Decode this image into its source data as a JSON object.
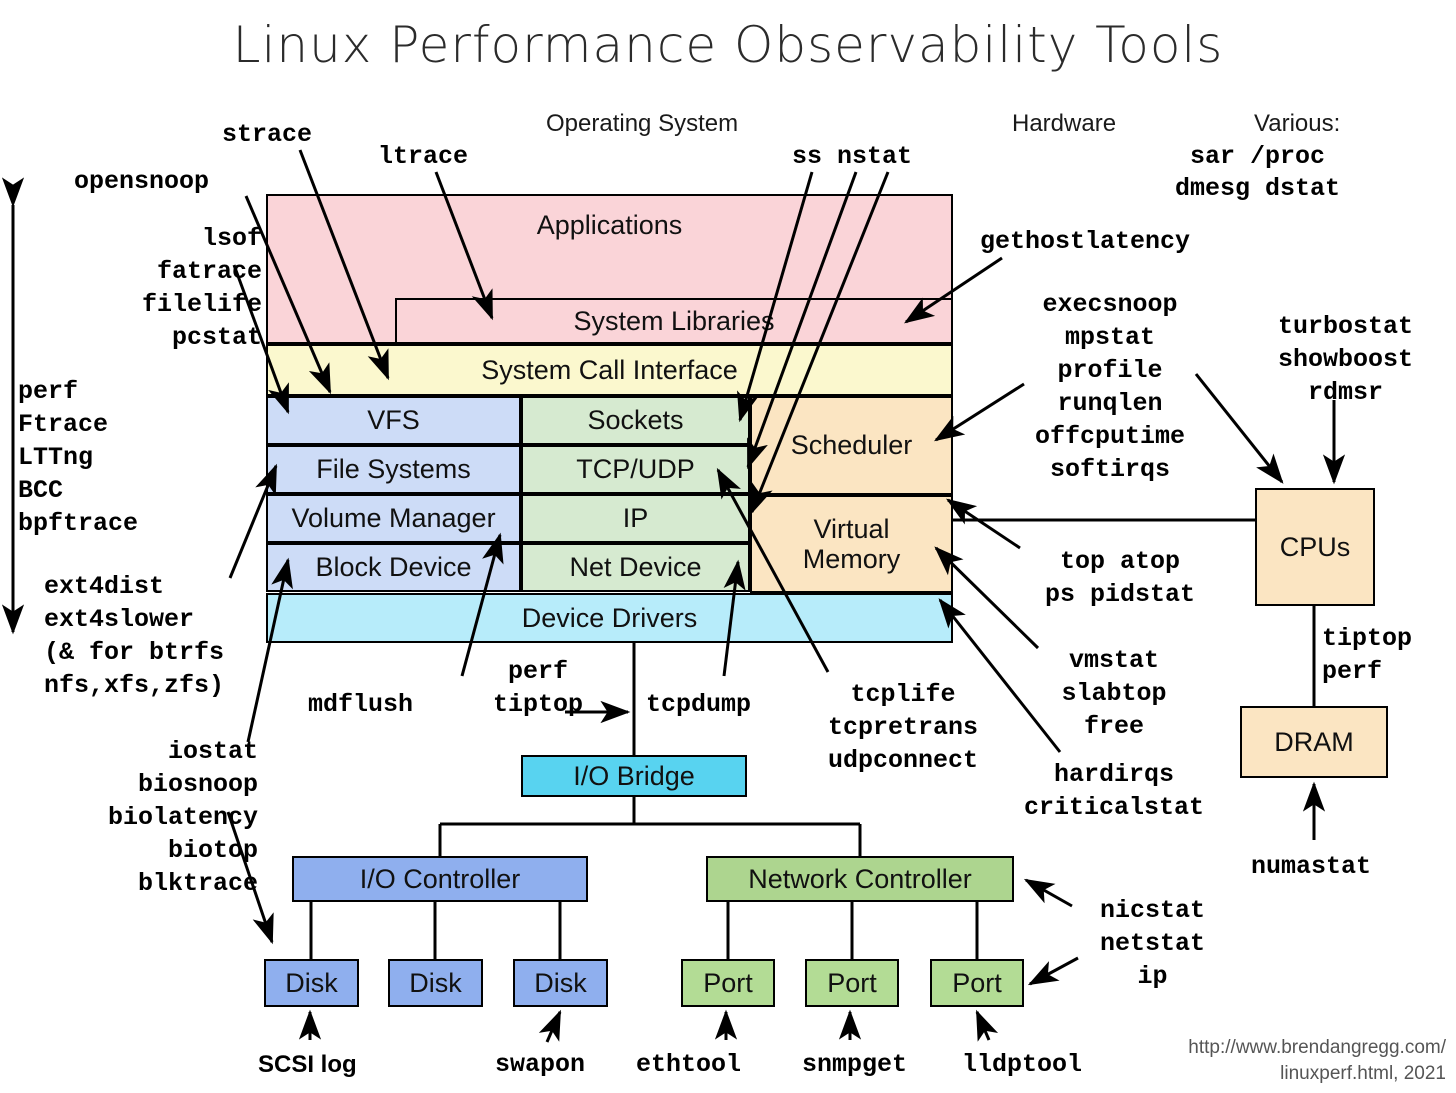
{
  "title": "Linux Performance Observability Tools",
  "captions": {
    "os": "Operating System",
    "hardware": "Hardware",
    "various": "Various:"
  },
  "stack": {
    "applications": "Applications",
    "system_libraries": "System Libraries",
    "system_call_interface": "System Call Interface",
    "vfs": "VFS",
    "sockets": "Sockets",
    "scheduler": "Scheduler",
    "file_systems": "File Systems",
    "tcp_udp": "TCP/UDP",
    "volume_manager": "Volume Manager",
    "ip": "IP",
    "virtual_memory": "Virtual\nMemory",
    "virtual_memory_l1": "Virtual",
    "virtual_memory_l2": "Memory",
    "block_device": "Block Device",
    "net_device": "Net Device",
    "device_drivers": "Device Drivers"
  },
  "hardware_boxes": {
    "io_bridge": "I/O Bridge",
    "io_controller": "I/O Controller",
    "network_controller": "Network Controller",
    "disk1": "Disk",
    "disk2": "Disk",
    "disk3": "Disk",
    "port1": "Port",
    "port2": "Port",
    "port3": "Port",
    "cpus": "CPUs",
    "dram": "DRAM"
  },
  "tools": {
    "strace": "strace",
    "ltrace": "ltrace",
    "ss_nstat": "ss nstat",
    "opensnoop": "opensnoop",
    "various_line1": "sar /proc",
    "various_line2": "dmesg dstat",
    "file_group": "lsof\nfatrace\nfilelife\npcstat",
    "tracers": "perf\nFtrace\nLTTng\nBCC\nbpftrace",
    "ext4": "ext4dist\next4slower\n(& for btrfs\nnfs,xfs,zfs)",
    "io_tools": "iostat\nbiosnoop\nbiolatency\nbiotop\nblktrace",
    "mdflush": "mdflush",
    "perf_tiptop": "perf\ntiptop",
    "tcpdump": "tcpdump",
    "tcp_group": "tcplife\ntcpretrans\nudpconnect",
    "gethostlatency": "gethostlatency",
    "cpu_group": "execsnoop\nmpstat\nprofile\nrunqlen\noffcputime\nsoftirqs",
    "turbostat_group": "turbostat\nshowboost\nrdmsr",
    "top_group": "top atop\nps pidstat",
    "vmstat_group": "vmstat\nslabtop\nfree",
    "hardirqs_group": "hardirqs\ncriticalstat",
    "tiptop_perf": "tiptop\nperf",
    "numastat": "numastat",
    "nicstat_group": "nicstat\nnetstat\nip",
    "scsi_log": "SCSI log",
    "swapon": "swapon",
    "ethtool": "ethtool",
    "snmpget": "snmpget",
    "lldptool": "lldptool"
  },
  "attribution": {
    "line1": "http://www.brendangregg.com/",
    "line2": "linuxperf.html, 2021"
  },
  "colors": {
    "applications": "#fad4d8",
    "syscall": "#fbf8ce",
    "fs_blue": "#cddcf7",
    "net_green": "#d6ead0",
    "mem_orange": "#fbe5c2",
    "drivers_cyan": "#b7ecfa",
    "io_bridge": "#58d3f0",
    "io_controller": "#8fafee",
    "network_controller": "#add58f",
    "stroke": "#000000"
  }
}
